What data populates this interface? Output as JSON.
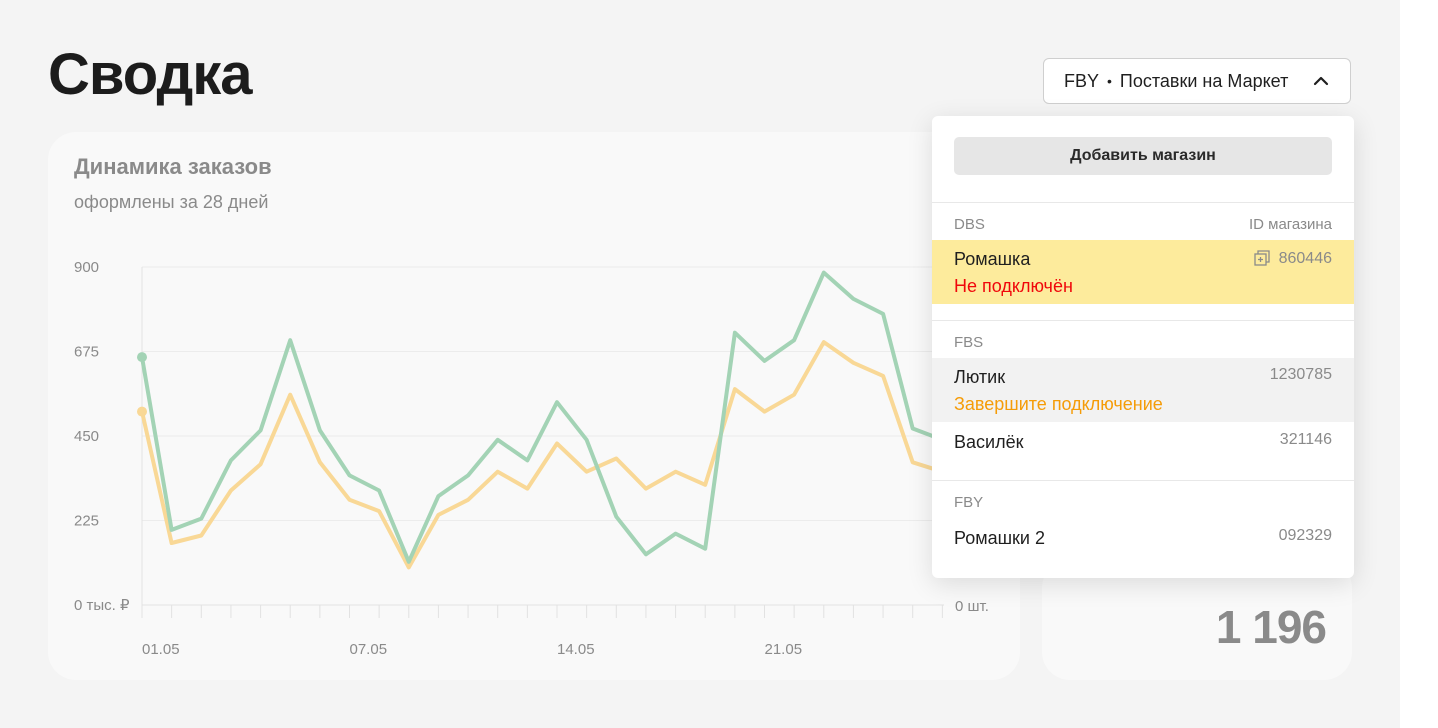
{
  "page": {
    "title": "Сводка"
  },
  "selector": {
    "model": "FBY",
    "separator": "•",
    "label": "Поставки на Маркет"
  },
  "orders_card": {
    "title": "Динамика заказов",
    "subtitle": "оформлены за 28 дней"
  },
  "side_card": {
    "total": "1 196"
  },
  "dropdown": {
    "add_button": "Добавить магазин",
    "id_header": "ID магазина",
    "groups": [
      {
        "label": "DBS",
        "shops": [
          {
            "name": "Ромашка",
            "id": "860446",
            "status": "Не подключён",
            "status_color": "#f0070b",
            "highlight": "#fdeb9c"
          }
        ]
      },
      {
        "label": "FBS",
        "shops": [
          {
            "name": "Лютик",
            "id": "1230785",
            "status": "Завершите подключение",
            "status_color": "#f59c08",
            "highlight": "#f2f2f2"
          },
          {
            "name": "Василёк",
            "id": "321146"
          }
        ]
      },
      {
        "label": "FBY",
        "shops": [
          {
            "name": "Ромашки 2",
            "id": "092329"
          }
        ]
      }
    ]
  },
  "chart_data": {
    "type": "line",
    "x_tick_labels": [
      "01.05",
      "07.05",
      "14.05",
      "21.05"
    ],
    "y_left_ticks": [
      "0 тыс. ₽",
      "225",
      "450",
      "675",
      "900"
    ],
    "y_right_ticks": [
      "0 шт."
    ],
    "ylim": [
      0,
      900
    ],
    "grid": true,
    "series": [
      {
        "color": "#a3d3b5",
        "values": [
          660,
          200,
          230,
          385,
          465,
          705,
          465,
          345,
          305,
          115,
          290,
          345,
          440,
          385,
          540,
          440,
          235,
          135,
          190,
          150,
          725,
          650,
          705,
          885,
          815,
          775,
          470,
          440,
          375
        ]
      },
      {
        "color": "#f9d896",
        "values": [
          515,
          165,
          185,
          305,
          375,
          560,
          380,
          280,
          250,
          100,
          240,
          280,
          355,
          310,
          430,
          355,
          390,
          310,
          355,
          320,
          575,
          515,
          560,
          700,
          645,
          610,
          380,
          355,
          290
        ]
      }
    ]
  },
  "colors": {
    "background": "#f4f4f4",
    "card": "#f9f9f9",
    "green_series": "#a3d3b5",
    "yellow_series": "#f9d896",
    "error": "#f0070b",
    "warning": "#f59c08",
    "highlight": "#fdeb9c"
  }
}
